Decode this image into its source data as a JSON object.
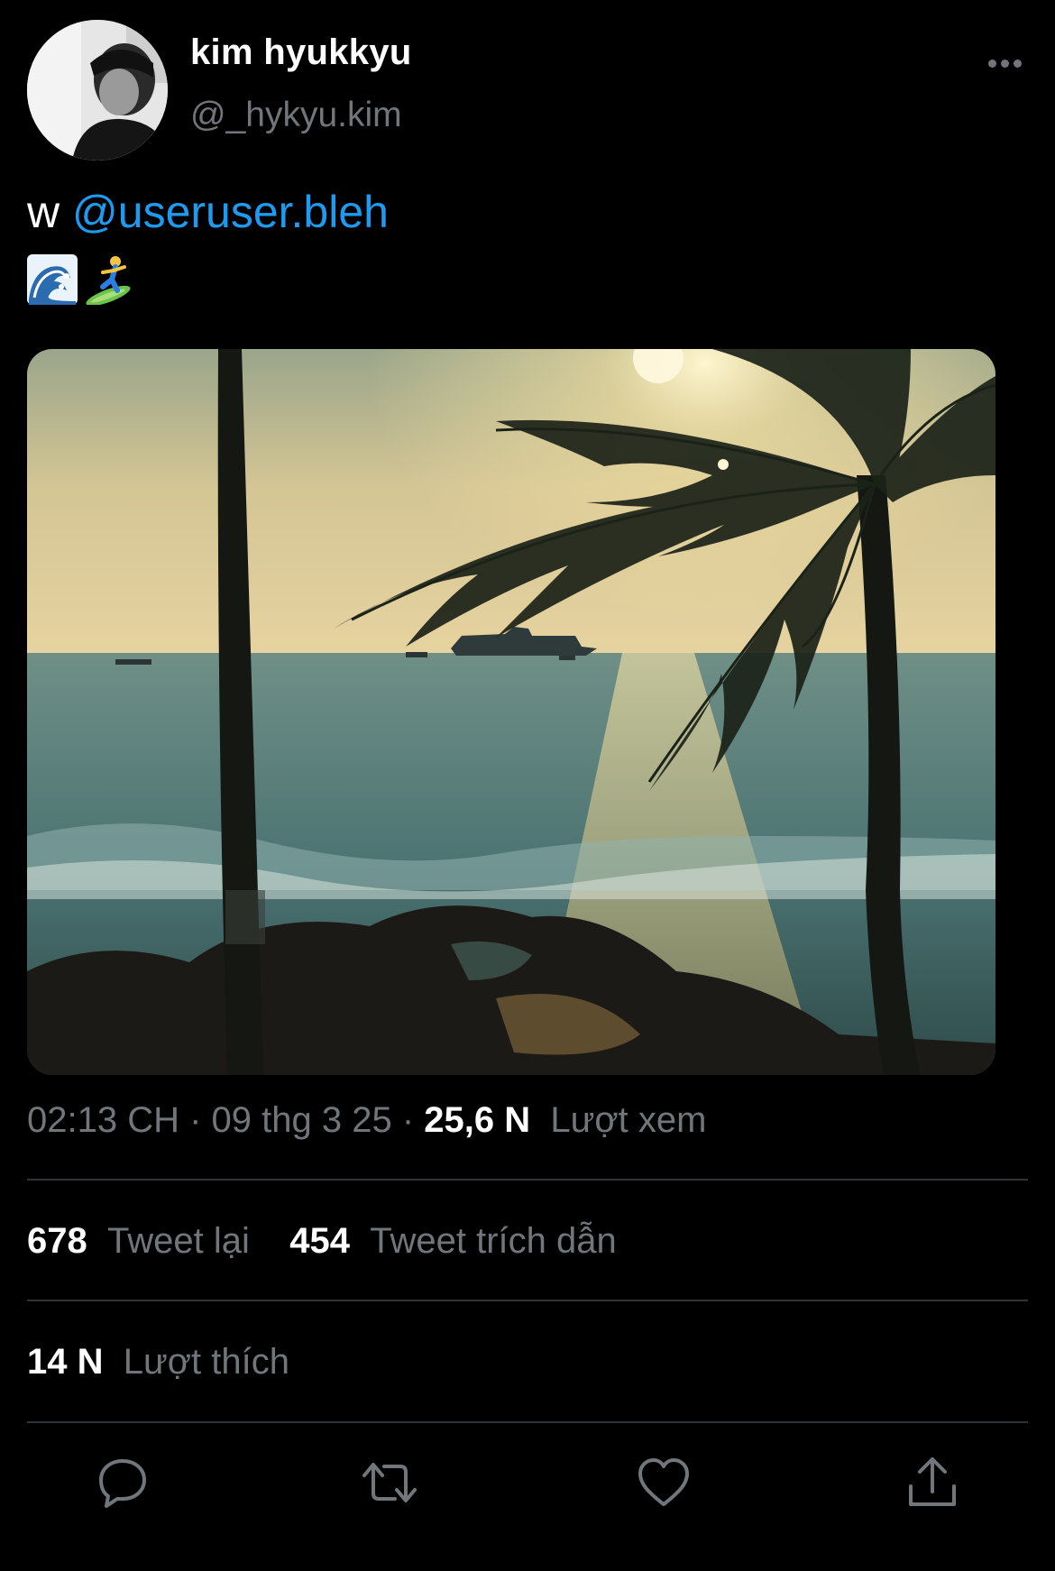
{
  "author": {
    "display_name": "kim hyukkyu",
    "handle": "@_hykyu.kim"
  },
  "tweet": {
    "prefix": "w ",
    "mention": "@useruser.bleh",
    "emojis": [
      "wave-emoji",
      "surfer-emoji"
    ]
  },
  "meta": {
    "time": "02:13 CH",
    "sep1": " · ",
    "date": "09 thg 3 25",
    "sep2": " · ",
    "views": "25,6 N",
    "views_label": "Lượt xem"
  },
  "stats": {
    "retweets": "678",
    "retweets_label": "Tweet lại",
    "quotes": "454",
    "quotes_label": "Tweet trích dẫn",
    "likes": "14 N",
    "likes_label": "Lượt thích"
  },
  "actions": [
    "reply-icon",
    "retweet-icon",
    "like-icon",
    "share-icon"
  ],
  "colors": {
    "background": "#000000",
    "link": "#1d9bf0",
    "secondary_text": "#71767b",
    "divider": "#2f3336"
  }
}
